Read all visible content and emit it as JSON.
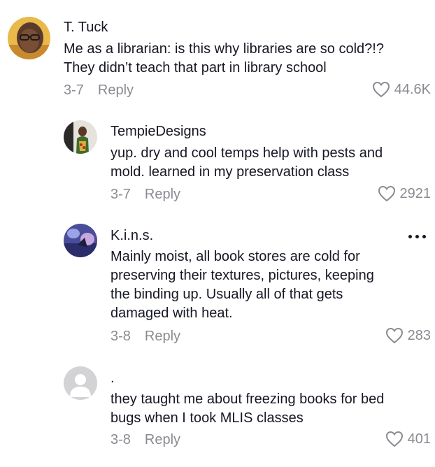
{
  "comments": [
    {
      "username": "T. Tuck",
      "text_lines": [
        "Me as a librarian: is this why libraries are so cold?!?",
        "They didn’t teach that part in library school"
      ],
      "date": "3-7",
      "reply_label": "Reply",
      "likes": "44.6K",
      "avatar_icon": "profile-photo"
    },
    {
      "username": "TempieDesigns",
      "text_lines": [
        "yup. dry and cool temps help with pests and",
        "mold. learned in my preservation class"
      ],
      "date": "3-7",
      "reply_label": "Reply",
      "likes": "2921",
      "avatar_icon": "profile-photo"
    },
    {
      "username": "K.i.n.s.",
      "text_lines": [
        "Mainly moist, all book stores are cold for",
        "preserving their textures, pictures, keeping",
        "the binding up. Usually all of that gets",
        "damaged with heat."
      ],
      "date": "3-8",
      "reply_label": "Reply",
      "likes": "283",
      "avatar_icon": "profile-photo"
    },
    {
      "username": ".",
      "text_lines": [
        "they taught me about freezing books for bed",
        "bugs when I took MLIS classes"
      ],
      "date": "3-8",
      "reply_label": "Reply",
      "likes": "401",
      "avatar_icon": "default-avatar"
    }
  ],
  "icons": {
    "like": "heart-outline-icon",
    "more": "more-options-icon"
  },
  "colors": {
    "text": "#161823",
    "muted": "#8a8b91",
    "default_avatar": "#d3d3d5"
  }
}
